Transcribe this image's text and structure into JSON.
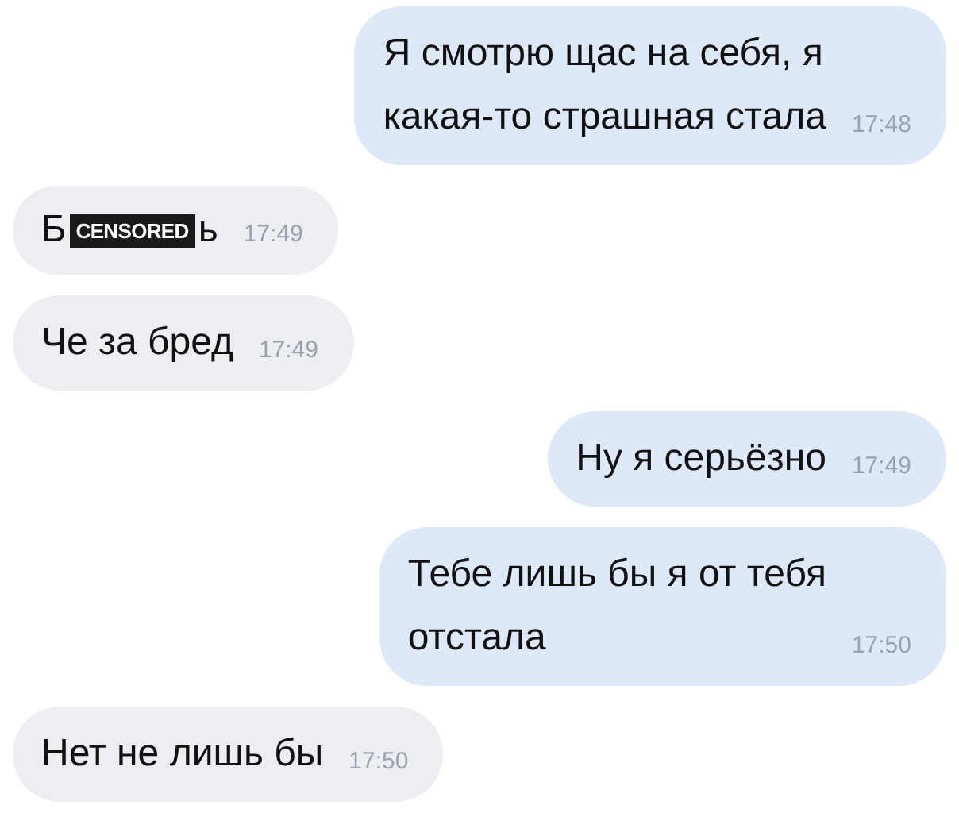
{
  "messages": [
    {
      "kind": "text",
      "outgoing": true,
      "text": "Я смотрю щас на себя, я\nкакая-то страшная стала",
      "time": "17:48"
    },
    {
      "kind": "censored",
      "outgoing": false,
      "text_before": "Б",
      "censor_label": "CENSORED",
      "text_after": "ь",
      "time": "17:49"
    },
    {
      "kind": "text",
      "outgoing": false,
      "text": "Че за бред",
      "time": "17:49"
    },
    {
      "kind": "text",
      "outgoing": true,
      "text": "Ну я серьёзно",
      "time": "17:49"
    },
    {
      "kind": "text",
      "outgoing": true,
      "text": "Тебе лишь бы я от тебя\nотстала",
      "time": "17:50"
    },
    {
      "kind": "text",
      "outgoing": false,
      "text": "Нет не лишь бы",
      "time": "17:50"
    }
  ]
}
